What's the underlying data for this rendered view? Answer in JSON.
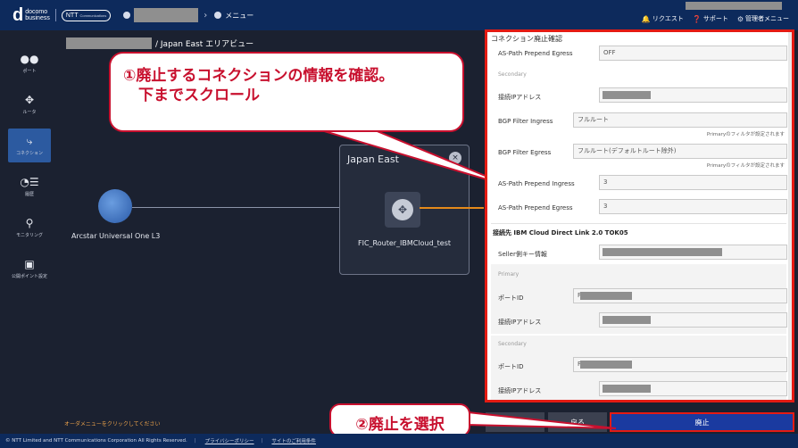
{
  "header": {
    "logo_main": "d",
    "logo_text_1": "docomo",
    "logo_text_2": "business",
    "ntt_logo": "NTT",
    "ntt_logo_sub": "Communications",
    "crumb_chevron": "›",
    "crumb_menu": "メニュー",
    "request": "リクエスト",
    "support": "サポート",
    "admin_menu": "管理者メニュー"
  },
  "sidebar": {
    "items": [
      {
        "icon": "●●",
        "label": "ポート"
      },
      {
        "icon": "✥",
        "label": "ルータ"
      },
      {
        "icon": "⤷",
        "label": "コネクション"
      },
      {
        "icon": "◔☰",
        "label": "履歴"
      },
      {
        "icon": "⚲",
        "label": "モニタリング"
      },
      {
        "icon": "▣",
        "label": "公開ポイント設定"
      }
    ]
  },
  "canvas": {
    "area_title": "/ Japan East エリアビュー",
    "endpoint_label": "Arcstar Universal One L3",
    "router_box_title": "Japan East",
    "router_close": "×",
    "router_icon": "✥",
    "router_name": "FIC_Router_IBMCloud_test",
    "order_hint": "オーダメニューをクリックしてください"
  },
  "callout1": {
    "text": "①廃止するコネクションの情報を確認。\n　下までスクロール"
  },
  "callout2": {
    "text": "②廃止を選択"
  },
  "panel": {
    "title": "コネクション廃止確認",
    "as_path_egress_label": "AS-Path Prepend Egress",
    "as_path_egress_value": "OFF",
    "secondary_label": "Secondary",
    "ip_label": "接続IPアドレス",
    "bgp_ingress_label": "BGP Filter Ingress",
    "bgp_ingress_value": "フルルート",
    "bgp_ingress_note": "Primaryのフィルタが設定されます",
    "bgp_egress_label": "BGP Filter Egress",
    "bgp_egress_value": "フルルート(デフォルトルート除外)",
    "bgp_egress_note": "Primaryのフィルタが設定されます",
    "as_ingress_label": "AS-Path Prepend Ingress",
    "as_ingress_value": "3",
    "as_egress2_label": "AS-Path Prepend Egress",
    "as_egress2_value": "3",
    "dest_section": "接続先 IBM Cloud Direct Link 2.0 TOK05",
    "seller_key_label": "Seller側キー情報",
    "primary_label": "Primary",
    "port_id_label": "ポートID",
    "port_id_prefix": "F",
    "ip2_label": "接続IPアドレス",
    "secondary2_label": "Secondary",
    "port_id2_label": "ポートID",
    "port_id2_prefix": "F",
    "ip3_label": "接続IPアドレス"
  },
  "buttons": {
    "cancel": "キャンセル",
    "back": "戻る",
    "abolish": "廃止"
  },
  "footer": {
    "copyright": "© NTT Limited and NTT Communications Corporation All Rights Reserved.",
    "privacy": "プライバシーポリシー",
    "terms": "サイトのご利用条件"
  }
}
